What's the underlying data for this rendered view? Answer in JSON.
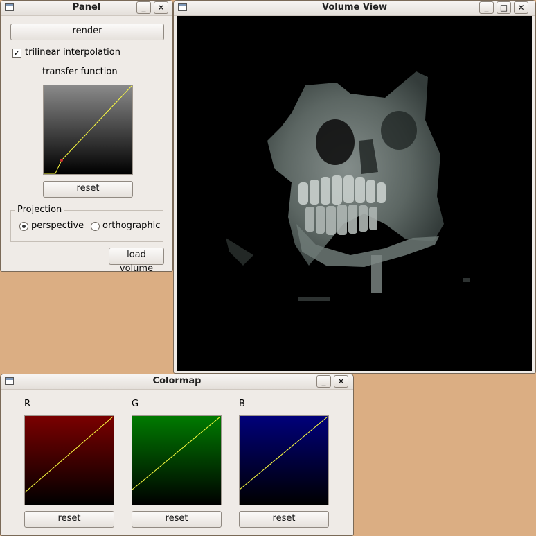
{
  "panel": {
    "title": "Panel",
    "render_label": "render",
    "trilinear_label": "trilinear interpolation",
    "trilinear_checked": true,
    "transfer_label": "transfer function",
    "reset_label": "reset",
    "projection": {
      "title": "Projection",
      "perspective_label": "perspective",
      "orthographic_label": "orthographic",
      "selected": "perspective"
    },
    "load_label": "load volume"
  },
  "volume_view": {
    "title": "Volume View"
  },
  "colormap": {
    "title": "Colormap",
    "channels": [
      {
        "label": "R",
        "color": "#7a0000",
        "reset_label": "reset"
      },
      {
        "label": "G",
        "color": "#007a00",
        "reset_label": "reset"
      },
      {
        "label": "B",
        "color": "#00007a",
        "reset_label": "reset"
      }
    ]
  },
  "icons": {
    "minimize": "_",
    "maximize": "□",
    "close": "✕",
    "check": "✓"
  },
  "colors": {
    "desktop": "#dbae83",
    "curve_line": "#ffff40",
    "control_point": "#d03030"
  }
}
